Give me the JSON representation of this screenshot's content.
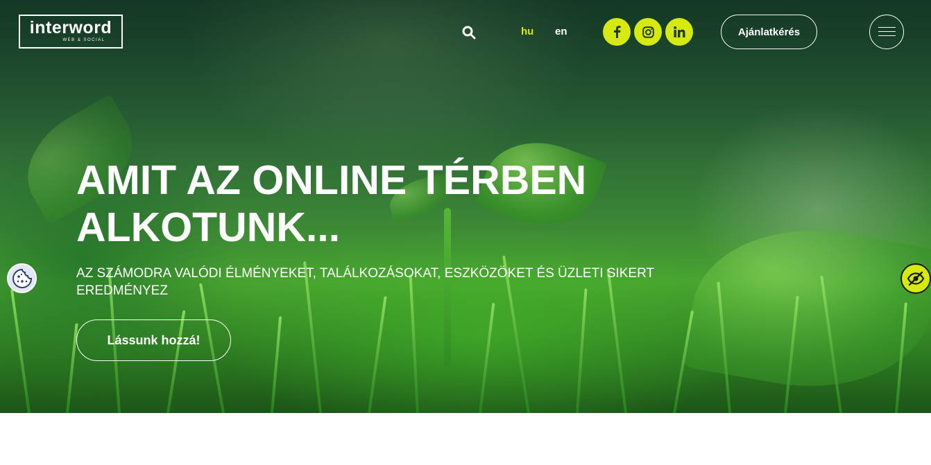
{
  "header": {
    "logo": {
      "name": "interword",
      "tagline": "WEB & SOCIAL"
    },
    "languages": [
      {
        "code": "hu",
        "active": true
      },
      {
        "code": "en",
        "active": false
      }
    ],
    "social": [
      {
        "name": "facebook",
        "icon": "facebook-icon"
      },
      {
        "name": "instagram",
        "icon": "instagram-icon"
      },
      {
        "name": "linkedin",
        "icon": "linkedin-icon"
      }
    ],
    "quote_button": "Ajánlatkérés"
  },
  "hero": {
    "title": "AMIT AZ ONLINE TÉRBEN ALKOTUNK...",
    "subtitle": "AZ SZÁMODRA VALÓDI ÉLMÉNYEKET, TALÁLKOZÁSOKAT, ESZKÖZÖKET ÉS ÜZLETI SIKERT EREDMÉNYEZ",
    "cta": "Lássunk hozzá!"
  },
  "colors": {
    "accent": "#d6ea12",
    "text": "#ffffff",
    "social_icon": "#1e3a20"
  }
}
